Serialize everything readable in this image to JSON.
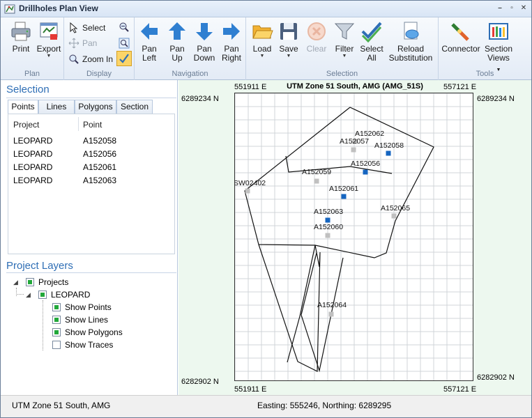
{
  "window": {
    "title": "Drillholes Plan View"
  },
  "ribbon": {
    "plan": {
      "label": "Plan",
      "print": "Print",
      "export": "Export"
    },
    "display": {
      "label": "Display",
      "select": "Select",
      "pan": "Pan",
      "zoom_in": "Zoom In"
    },
    "navigation": {
      "label": "Navigation",
      "pan_left": [
        "Pan",
        "Left"
      ],
      "pan_up": [
        "Pan",
        "Up"
      ],
      "pan_down": [
        "Pan",
        "Down"
      ],
      "pan_right": [
        "Pan",
        "Right"
      ]
    },
    "selection": {
      "label": "Selection",
      "load": "Load",
      "save": "Save",
      "clear": "Clear",
      "filter": "Filter",
      "select_all": [
        "Select",
        "All"
      ],
      "reload": [
        "Reload",
        "Substitution"
      ]
    },
    "tools": {
      "label": "Tools",
      "connector": "Connector",
      "section_views": [
        "Section",
        "Views"
      ]
    }
  },
  "selection_panel": {
    "title": "Selection",
    "tabs": [
      "Points",
      "Lines",
      "Polygons",
      "Section"
    ],
    "active_tab": "Points",
    "columns": [
      "Project",
      "Point"
    ],
    "rows": [
      [
        "LEOPARD",
        "A152058"
      ],
      [
        "LEOPARD",
        "A152056"
      ],
      [
        "LEOPARD",
        "A152061"
      ],
      [
        "LEOPARD",
        "A152063"
      ]
    ]
  },
  "layers_panel": {
    "title": "Project Layers",
    "root": {
      "label": "Projects",
      "checked": true
    },
    "project": {
      "label": "LEOPARD",
      "checked": true
    },
    "options": [
      {
        "label": "Show Points",
        "checked": true
      },
      {
        "label": "Show Lines",
        "checked": true
      },
      {
        "label": "Show Polygons",
        "checked": true
      },
      {
        "label": "Show Traces",
        "checked": false
      }
    ]
  },
  "map": {
    "title": "UTM Zone 51 South, AMG (AMG_51S)",
    "top_left_e": "551911 E",
    "top_right_e": "557121 E",
    "bottom_left_e": "551911 E",
    "bottom_right_e": "557121 E",
    "top_n_left": "6289234 N",
    "top_n_right": "6289234 N",
    "bottom_n_left": "6282902 N",
    "bottom_n_right": "6282902 N",
    "points": [
      {
        "label": "A152062",
        "selected": false
      },
      {
        "label": "A152057",
        "selected": false
      },
      {
        "label": "A152058",
        "selected": true
      },
      {
        "label": "A152056",
        "selected": true
      },
      {
        "label": "A152059",
        "selected": false
      },
      {
        "label": "SW02402",
        "selected": false
      },
      {
        "label": "A152061",
        "selected": true
      },
      {
        "label": "A152065",
        "selected": false
      },
      {
        "label": "A152063",
        "selected": true
      },
      {
        "label": "A152060",
        "selected": false
      },
      {
        "label": "A152064",
        "selected": false
      }
    ],
    "colors": {
      "selected": "#1565c0",
      "unselected": "#c0c0c0",
      "background": "#edf8ef"
    }
  },
  "status": {
    "left": "UTM Zone 51 South, AMG",
    "right": "Easting: 555246, Northing: 6289295"
  }
}
